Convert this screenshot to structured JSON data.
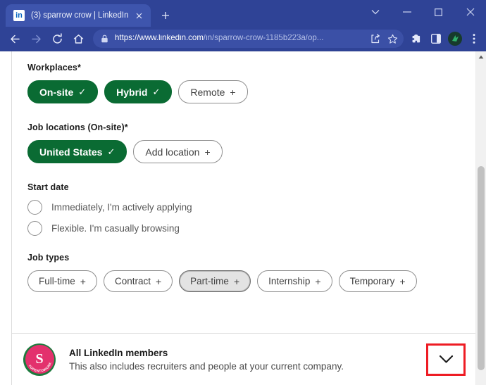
{
  "browser": {
    "tab": {
      "favicon_text": "in",
      "title": "(3) sparrow crow | LinkedIn",
      "close_icon": "close-icon"
    },
    "new_tab_label": "+",
    "window_controls": {
      "tab_search": "chevron-down-icon",
      "minimize": "minimize-icon",
      "maximize": "maximize-icon",
      "close": "close-icon"
    },
    "nav": {
      "back": "back-arrow-icon",
      "forward": "forward-arrow-icon",
      "reload": "reload-icon",
      "home": "home-icon"
    },
    "omnibox": {
      "lock_icon": "lock-icon",
      "url_domain": "https://www.linkedin.com",
      "url_path": "/in/sparrow-crow-1185b223a/op...",
      "share_icon": "share-icon",
      "bookmark_icon": "star-icon"
    },
    "toolbar_icons": {
      "extensions": "puzzle-piece-icon",
      "side_panel": "side-panel-icon",
      "profile": "profile-avatar-icon",
      "menu": "three-dot-menu-icon"
    }
  },
  "page": {
    "workplaces": {
      "label": "Workplaces*",
      "options": [
        {
          "text": "On-site",
          "glyph": "✓",
          "state": "selected"
        },
        {
          "text": "Hybrid",
          "glyph": "✓",
          "state": "selected"
        },
        {
          "text": "Remote",
          "glyph": "+",
          "state": "default"
        }
      ]
    },
    "job_locations": {
      "label": "Job locations (On-site)*",
      "options": [
        {
          "text": "United States",
          "glyph": "✓",
          "state": "selected"
        },
        {
          "text": "Add location",
          "glyph": "+",
          "state": "default"
        }
      ]
    },
    "start_date": {
      "label": "Start date",
      "options": [
        {
          "text": "Immediately, I'm actively applying",
          "checked": false
        },
        {
          "text": "Flexible. I'm casually browsing",
          "checked": false
        }
      ]
    },
    "job_types": {
      "label": "Job types",
      "options": [
        {
          "text": "Full-time",
          "glyph": "+",
          "state": "default"
        },
        {
          "text": "Contract",
          "glyph": "+",
          "state": "default"
        },
        {
          "text": "Part-time",
          "glyph": "+",
          "state": "hover"
        },
        {
          "text": "Internship",
          "glyph": "+",
          "state": "default"
        },
        {
          "text": "Temporary",
          "glyph": "+",
          "state": "default"
        }
      ]
    },
    "footer": {
      "avatar_initial": "S",
      "avatar_badge": "#OPENTOWORK",
      "title": "All LinkedIn members",
      "subtitle": "This also includes recruiters and people at your current company.",
      "expand_icon": "chevron-down-icon",
      "highlight_color": "#ee1c24"
    }
  },
  "colors": {
    "chrome": "#2f4396",
    "tab_active": "#3e55ad",
    "linkedin_green": "#0a6b33",
    "avatar_pink": "#e3316d",
    "avatar_ring_green": "#1d7a3d",
    "highlight_red": "#ee1c24"
  }
}
